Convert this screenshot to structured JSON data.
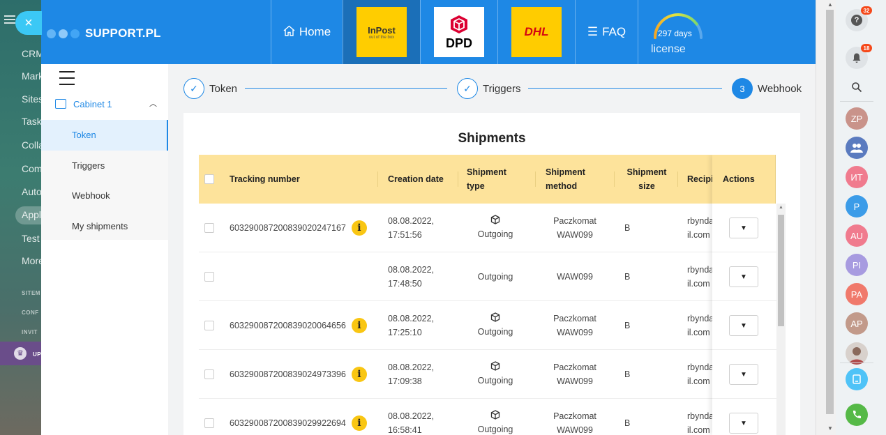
{
  "bitrix_sidebar": {
    "items": [
      "CRM",
      "Mark",
      "Sites",
      "Task",
      "Colla",
      "Com",
      "Auto",
      "Appl",
      "Test",
      "More"
    ],
    "sections": [
      "SITEM",
      "CONF",
      "INVIT"
    ],
    "upgrade_label": "UP"
  },
  "header": {
    "brand": "SUPPORT.PL",
    "nav_home": "Home",
    "carriers": {
      "inpost": "InPost",
      "inpost_tag": "out of the box",
      "dpd": "DPD",
      "dhl": "DHL"
    },
    "nav_faq": "FAQ",
    "license_days": "297 days",
    "license_label": "license",
    "license_fraction": 0.8
  },
  "app_sidebar": {
    "cabinet": "Cabinet 1",
    "items": [
      {
        "label": "Token",
        "active": true
      },
      {
        "label": "Triggers",
        "active": false
      },
      {
        "label": "Webhook",
        "active": false
      },
      {
        "label": "My shipments",
        "active": false
      }
    ]
  },
  "stepper": {
    "steps": [
      {
        "label": "Token",
        "state": "done"
      },
      {
        "label": "Triggers",
        "state": "done"
      },
      {
        "label": "Webhook",
        "state": "current",
        "number": "3"
      }
    ]
  },
  "shipments": {
    "title": "Shipments",
    "columns": {
      "tracking": "Tracking number",
      "created": "Creation date",
      "type": "Shipment type",
      "method": "Shipment method",
      "size": "Shipment size",
      "recipient": "Recipi",
      "actions": "Actions"
    },
    "rows": [
      {
        "tracking": "603290087200839020247167",
        "info": true,
        "date": "08.08.2022,",
        "time": "17:51:56",
        "type_icon": true,
        "type": "Outgoing",
        "method1": "Paczkomat",
        "method2": "WAW099",
        "size": "B",
        "recip1": "rbynda",
        "recip2": "il.com"
      },
      {
        "tracking": "",
        "info": false,
        "date": "08.08.2022,",
        "time": "17:48:50",
        "type_icon": false,
        "type": "Outgoing",
        "method1": "",
        "method2": "WAW099",
        "size": "B",
        "recip1": "rbynda",
        "recip2": "il.com"
      },
      {
        "tracking": "603290087200839020064656",
        "info": true,
        "date": "08.08.2022,",
        "time": "17:25:10",
        "type_icon": true,
        "type": "Outgoing",
        "method1": "Paczkomat",
        "method2": "WAW099",
        "size": "B",
        "recip1": "rbynda",
        "recip2": "il.com"
      },
      {
        "tracking": "603290087200839024973396",
        "info": true,
        "date": "08.08.2022,",
        "time": "17:09:38",
        "type_icon": true,
        "type": "Outgoing",
        "method1": "Paczkomat",
        "method2": "WAW099",
        "size": "B",
        "recip1": "rbynda",
        "recip2": "il.com"
      },
      {
        "tracking": "603290087200839029922694",
        "info": true,
        "date": "08.08.2022,",
        "time": "16:58:41",
        "type_icon": true,
        "type": "Outgoing",
        "method1": "Paczkomat",
        "method2": "WAW099",
        "size": "B",
        "recip1": "rbynda",
        "recip2": "il.com"
      }
    ]
  },
  "right_bar": {
    "help_badge": "32",
    "notif_badge": "18",
    "avatars": [
      {
        "initials": "ZP",
        "color": "#c9938a"
      },
      {
        "initials": "",
        "color": "#5a7bbf",
        "icon": "group-icon"
      },
      {
        "initials": "ИТ",
        "color": "#f07b8e"
      },
      {
        "initials": "P",
        "color": "#3b9ce8"
      },
      {
        "initials": "AU",
        "color": "#f07b8e"
      },
      {
        "initials": "PI",
        "color": "#a79be0"
      },
      {
        "initials": "PA",
        "color": "#f0796b"
      },
      {
        "initials": "AP",
        "color": "#c29a8a"
      }
    ]
  },
  "colors": {
    "primary": "#1e88e5",
    "header_yellow": "#fde39b",
    "info_yellow": "#f9c613",
    "call_green": "#55b947"
  }
}
